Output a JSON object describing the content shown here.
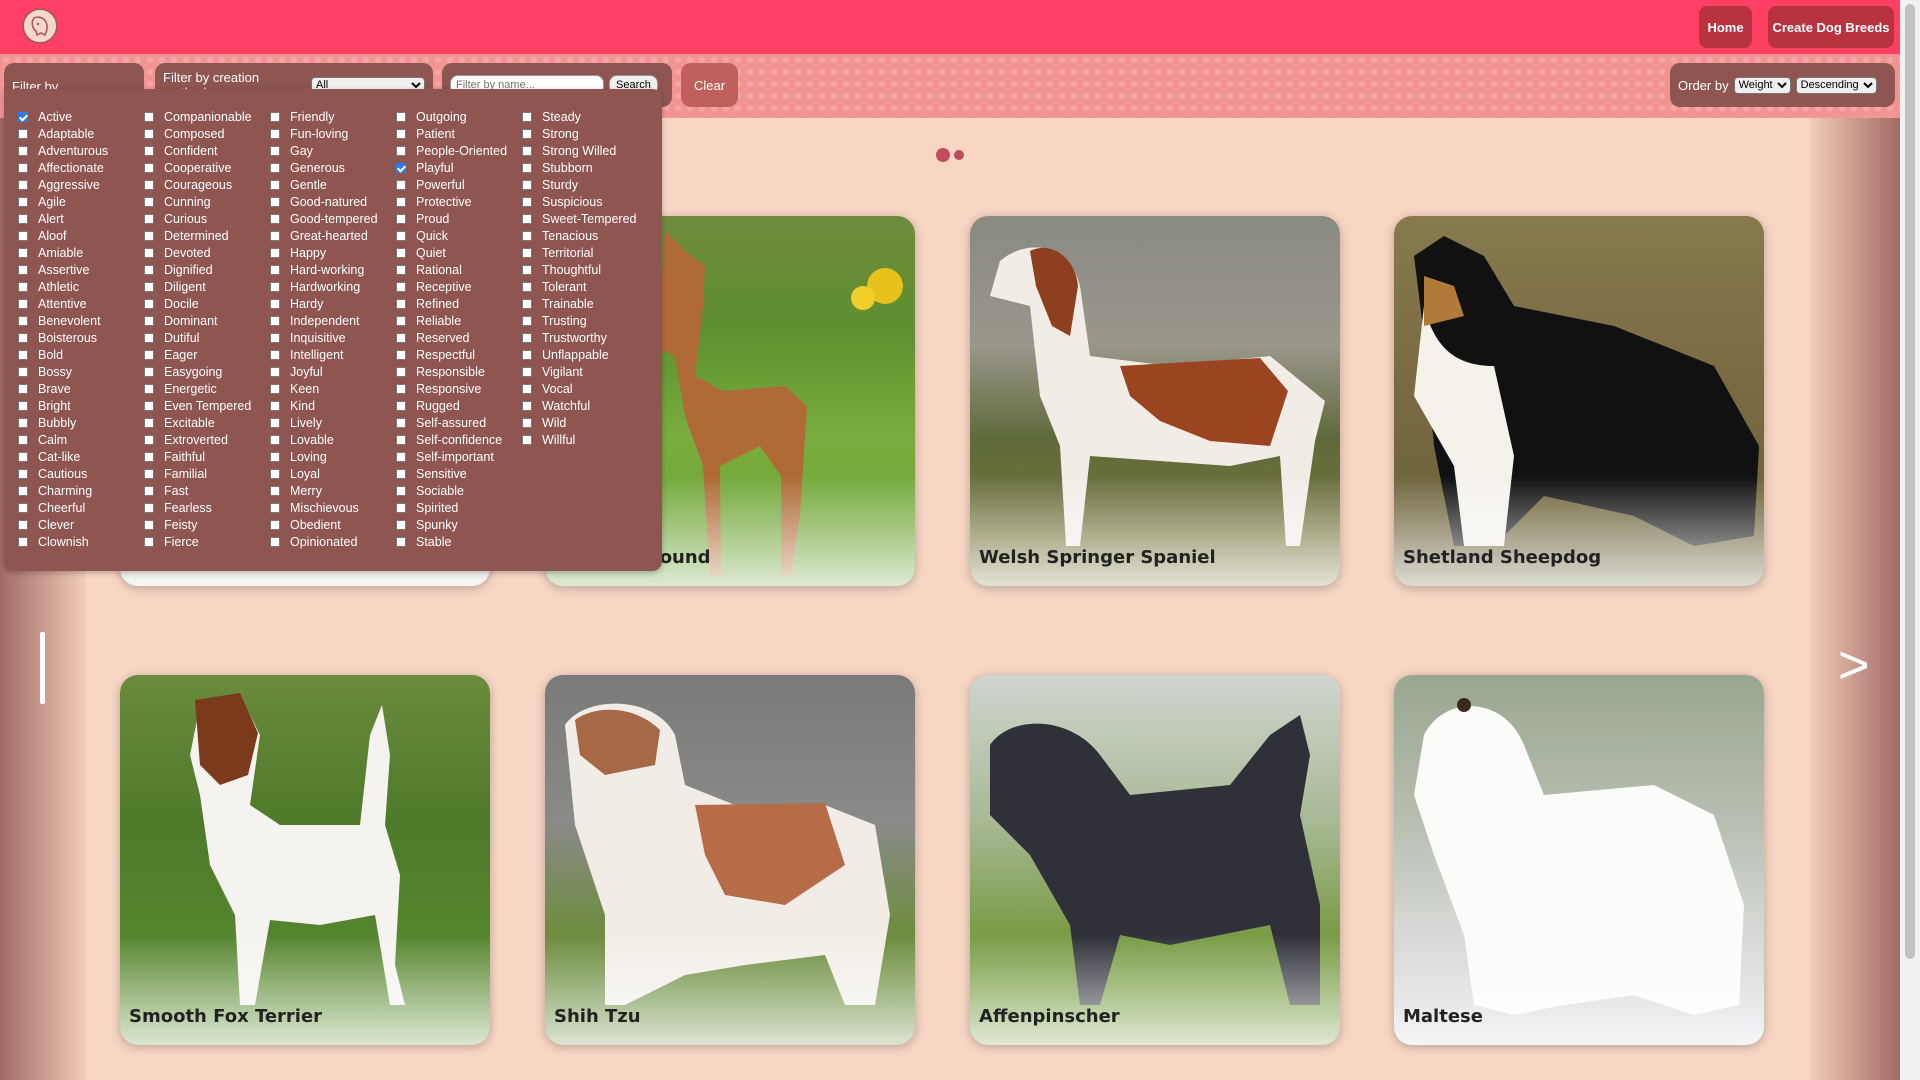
{
  "nav": {
    "home_label": "Home",
    "create_label": "Create Dog Breeds"
  },
  "filters": {
    "temperaments_label": "Filter by temperaments",
    "creation_label": "Filter by creation method",
    "creation_value": "All",
    "search_placeholder": "Filter by name...",
    "search_label": "Search",
    "clear_label": "Clear",
    "order_label": "Order by",
    "order_by_value": "Weight",
    "order_dir_value": "Descending"
  },
  "temperaments": [
    [
      {
        "label": "Active",
        "checked": true
      },
      {
        "label": "Adaptable"
      },
      {
        "label": "Adventurous"
      },
      {
        "label": "Affectionate"
      },
      {
        "label": "Aggressive"
      },
      {
        "label": "Agile"
      },
      {
        "label": "Alert"
      },
      {
        "label": "Aloof"
      },
      {
        "label": "Amiable"
      },
      {
        "label": "Assertive"
      },
      {
        "label": "Athletic"
      },
      {
        "label": "Attentive"
      },
      {
        "label": "Benevolent"
      },
      {
        "label": "Boisterous"
      },
      {
        "label": "Bold"
      },
      {
        "label": "Bossy"
      },
      {
        "label": "Brave"
      },
      {
        "label": "Bright"
      },
      {
        "label": "Bubbly"
      },
      {
        "label": "Calm"
      },
      {
        "label": "Cat-like"
      },
      {
        "label": "Cautious"
      },
      {
        "label": "Charming"
      },
      {
        "label": "Cheerful"
      },
      {
        "label": "Clever"
      },
      {
        "label": "Clownish"
      }
    ],
    [
      {
        "label": "Companionable"
      },
      {
        "label": "Composed"
      },
      {
        "label": "Confident"
      },
      {
        "label": "Cooperative"
      },
      {
        "label": "Courageous"
      },
      {
        "label": "Cunning"
      },
      {
        "label": "Curious"
      },
      {
        "label": "Determined"
      },
      {
        "label": "Devoted"
      },
      {
        "label": "Dignified"
      },
      {
        "label": "Diligent"
      },
      {
        "label": "Docile"
      },
      {
        "label": "Dominant"
      },
      {
        "label": "Dutiful"
      },
      {
        "label": "Eager"
      },
      {
        "label": "Easygoing"
      },
      {
        "label": "Energetic"
      },
      {
        "label": "Even Tempered"
      },
      {
        "label": "Excitable"
      },
      {
        "label": "Extroverted"
      },
      {
        "label": "Faithful"
      },
      {
        "label": "Familial"
      },
      {
        "label": "Fast"
      },
      {
        "label": "Fearless"
      },
      {
        "label": "Feisty"
      },
      {
        "label": "Fierce"
      }
    ],
    [
      {
        "label": "Friendly"
      },
      {
        "label": "Fun-loving"
      },
      {
        "label": "Gay"
      },
      {
        "label": "Generous"
      },
      {
        "label": "Gentle"
      },
      {
        "label": "Good-natured"
      },
      {
        "label": "Good-tempered"
      },
      {
        "label": "Great-hearted"
      },
      {
        "label": "Happy"
      },
      {
        "label": "Hard-working"
      },
      {
        "label": "Hardworking"
      },
      {
        "label": "Hardy"
      },
      {
        "label": "Independent"
      },
      {
        "label": "Inquisitive"
      },
      {
        "label": "Intelligent"
      },
      {
        "label": "Joyful"
      },
      {
        "label": "Keen"
      },
      {
        "label": "Kind"
      },
      {
        "label": "Lively"
      },
      {
        "label": "Lovable"
      },
      {
        "label": "Loving"
      },
      {
        "label": "Loyal"
      },
      {
        "label": "Merry"
      },
      {
        "label": "Mischievous"
      },
      {
        "label": "Obedient"
      },
      {
        "label": "Opinionated"
      }
    ],
    [
      {
        "label": "Outgoing"
      },
      {
        "label": "Patient"
      },
      {
        "label": "People-Oriented"
      },
      {
        "label": "Playful",
        "checked": true
      },
      {
        "label": "Powerful"
      },
      {
        "label": "Protective"
      },
      {
        "label": "Proud"
      },
      {
        "label": "Quick"
      },
      {
        "label": "Quiet"
      },
      {
        "label": "Rational"
      },
      {
        "label": "Receptive"
      },
      {
        "label": "Refined"
      },
      {
        "label": "Reliable"
      },
      {
        "label": "Reserved"
      },
      {
        "label": "Respectful"
      },
      {
        "label": "Responsible"
      },
      {
        "label": "Responsive"
      },
      {
        "label": "Rugged"
      },
      {
        "label": "Self-assured"
      },
      {
        "label": "Self-confidence"
      },
      {
        "label": "Self-important"
      },
      {
        "label": "Sensitive"
      },
      {
        "label": "Sociable"
      },
      {
        "label": "Spirited"
      },
      {
        "label": "Spunky"
      },
      {
        "label": "Stable"
      }
    ],
    [
      {
        "label": "Steady"
      },
      {
        "label": "Strong"
      },
      {
        "label": "Strong Willed"
      },
      {
        "label": "Stubborn"
      },
      {
        "label": "Sturdy"
      },
      {
        "label": "Suspicious"
      },
      {
        "label": "Sweet-Tempered"
      },
      {
        "label": "Tenacious"
      },
      {
        "label": "Territorial"
      },
      {
        "label": "Thoughtful"
      },
      {
        "label": "Tolerant"
      },
      {
        "label": "Trainable"
      },
      {
        "label": "Trusting"
      },
      {
        "label": "Trustworthy"
      },
      {
        "label": "Unflappable"
      },
      {
        "label": "Vigilant"
      },
      {
        "label": "Vocal"
      },
      {
        "label": "Watchful"
      },
      {
        "label": "Wild"
      },
      {
        "label": "Willful"
      }
    ]
  ],
  "cards": [
    {
      "name": "",
      "photo": "pale-grass"
    },
    {
      "name": "Pharaoh Hound",
      "photo": "brown-dog-on-grass"
    },
    {
      "name": "Welsh Springer Spaniel",
      "photo": "spaniel-on-stones"
    },
    {
      "name": "Shetland Sheepdog",
      "photo": "sheltie-on-field"
    },
    {
      "name": "Smooth Fox Terrier",
      "photo": "terrier-on-grass"
    },
    {
      "name": "Shih Tzu",
      "photo": "shihtzu-on-grass"
    },
    {
      "name": "Affenpinscher",
      "photo": "affenpinscher-on-grass"
    },
    {
      "name": "Maltese",
      "photo": "maltese-on-snow"
    }
  ],
  "pagination": {
    "active_dot": 1,
    "total_dots": 2
  },
  "colors": {
    "navbar": "#ff3f63",
    "panel": "#8e5551",
    "background": "#f7d6c4"
  }
}
